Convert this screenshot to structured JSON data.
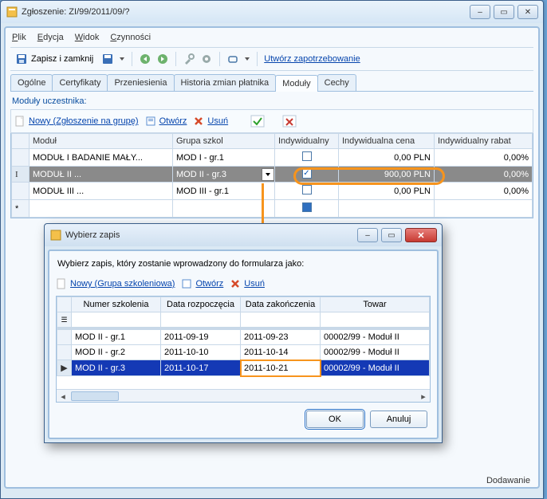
{
  "window": {
    "title": "Zgłoszenie: ZI/99/2011/09/?",
    "controls": {
      "min": "–",
      "max": "▭",
      "close": "✕"
    }
  },
  "menu": {
    "plik": "Plik",
    "edycja": "Edycja",
    "widok": "Widok",
    "czynnosci": "Czynności"
  },
  "toolbar": {
    "save_close": "Zapisz i zamknij",
    "link": "Utwórz zapotrzebowanie"
  },
  "tabs": {
    "t0": "Ogólne",
    "t1": "Certyfikaty",
    "t2": "Przeniesienia",
    "t3": "Historia zmian płatnika",
    "t4": "Moduły",
    "t5": "Cechy"
  },
  "section_title": "Moduły uczestnika:",
  "sub_toolbar": {
    "nowy": "Nowy (Zgłoszenie na grupę)",
    "otworz": "Otwórz",
    "usun": "Usuń"
  },
  "grid": {
    "cols": {
      "modul": "Moduł",
      "grupa": "Grupa szkol",
      "indyw": "Indywidualny",
      "cena": "Indywidualna cena",
      "rabat": "Indywidualny rabat"
    },
    "row0": {
      "m": "MODUŁ I BADANIE MAŁY...",
      "g": "MOD I - gr.1",
      "c": "0,00 PLN",
      "r": "0,00%"
    },
    "row1": {
      "m": "MODUŁ II ...",
      "g": "MOD II - gr.3",
      "c": "900,00 PLN",
      "r": "0,00%"
    },
    "row2": {
      "m": "MODUŁ III ...",
      "g": "MOD III - gr.1",
      "c": "0,00 PLN",
      "r": "0,00%"
    }
  },
  "modal": {
    "title": "Wybierz zapis",
    "controls": {
      "min": "–",
      "max": "▭",
      "close": "✕"
    },
    "prompt": "Wybierz zapis, który zostanie wprowadzony do formularza jako:",
    "toolbar": {
      "nowy": "Nowy (Grupa szkoleniowa)",
      "otworz": "Otwórz",
      "usun": "Usuń"
    },
    "cols": {
      "numer": "Numer szkolenia",
      "start": "Data rozpoczęcia",
      "end": "Data zakończenia",
      "towar": "Towar"
    },
    "row0": {
      "n": "MOD II - gr.1",
      "s": "2011-09-19",
      "e": "2011-09-23",
      "t": "00002/99 - Moduł II"
    },
    "row1": {
      "n": "MOD II - gr.2",
      "s": "2011-10-10",
      "e": "2011-10-14",
      "t": "00002/99 - Moduł II"
    },
    "row2": {
      "n": "MOD II - gr.3",
      "s": "2011-10-17",
      "e": "2011-10-21",
      "t": "00002/99 - Moduł II"
    },
    "ok": "OK",
    "cancel": "Anuluj"
  },
  "status": "Dodawanie"
}
